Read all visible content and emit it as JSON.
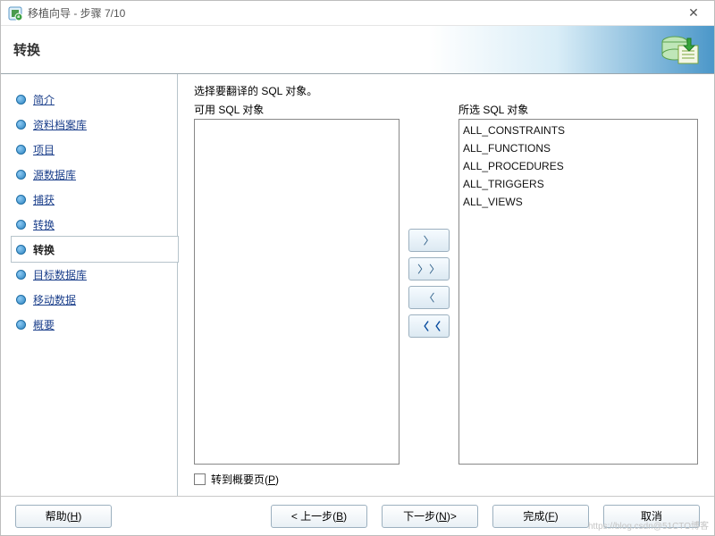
{
  "window": {
    "title": "移植向导 - 步骤 7/10"
  },
  "header": {
    "title": "转换"
  },
  "sidebar": {
    "steps": [
      {
        "label": "简介"
      },
      {
        "label": "资料档案库"
      },
      {
        "label": "项目"
      },
      {
        "label": "源数据库"
      },
      {
        "label": "捕获 "
      },
      {
        "label": "转换"
      },
      {
        "label": "转换"
      },
      {
        "label": "目标数据库"
      },
      {
        "label": "移动数据"
      },
      {
        "label": "概要"
      }
    ],
    "currentIndex": 6
  },
  "main": {
    "instruction": "选择要翻译的 SQL 对象。",
    "availableLabel": "可用 SQL 对象",
    "selectedLabel": "所选 SQL 对象",
    "available": [],
    "selected": [
      "ALL_CONSTRAINTS",
      "ALL_FUNCTIONS",
      "ALL_PROCEDURES",
      "ALL_TRIGGERS",
      "ALL_VIEWS"
    ],
    "gotoSummaryLabel": "转到概要页(",
    "gotoSummaryMnemonic": "P",
    "gotoSummaryTail": ")"
  },
  "transferButtons": {
    "moveRight": "〉",
    "moveAllRight": "〉〉",
    "moveLeft": "〈",
    "moveAllLeft": "〈〈"
  },
  "footer": {
    "help": "帮助",
    "helpM": "H",
    "back": "< 上一步",
    "backM": "B",
    "next": "下一步",
    "nextM": "N",
    "nextTail": " >",
    "finish": "完成",
    "finishM": "F",
    "cancel": "取消"
  }
}
